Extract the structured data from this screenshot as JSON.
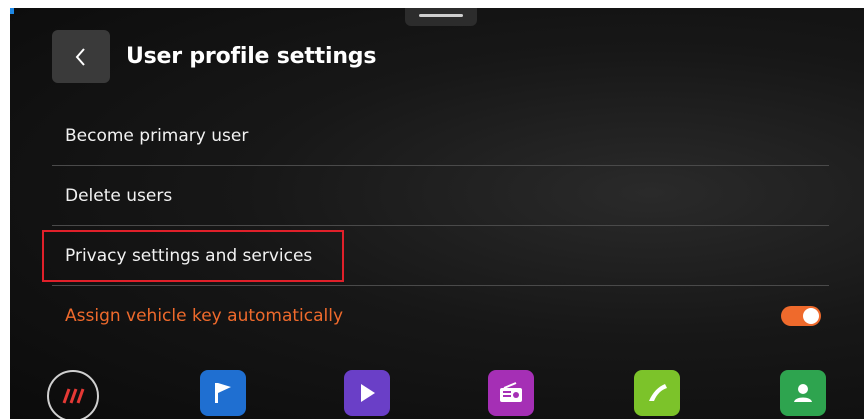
{
  "header": {
    "title": "User profile settings",
    "back_icon": "chevron-left-icon"
  },
  "menu": {
    "items": [
      {
        "label": "Become primary user"
      },
      {
        "label": "Delete users"
      },
      {
        "label": "Privacy settings and services"
      },
      {
        "label": "Assign vehicle key automatically",
        "toggle_on": true
      }
    ]
  },
  "dock": {
    "apps": [
      {
        "icon": "home-icon"
      },
      {
        "icon": "flag-icon",
        "color": "#1f6fd1"
      },
      {
        "icon": "play-icon",
        "color": "#6a3fc7"
      },
      {
        "icon": "radio-icon",
        "color": "#a52fb5"
      },
      {
        "icon": "phone-icon",
        "color": "#7cc32a"
      },
      {
        "icon": "contacts-icon",
        "color": "#2ea44f"
      }
    ]
  },
  "colors": {
    "accent_orange": "#ef6a2c",
    "highlight_red": "#e0202a",
    "text_primary": "#f2f2f2"
  }
}
